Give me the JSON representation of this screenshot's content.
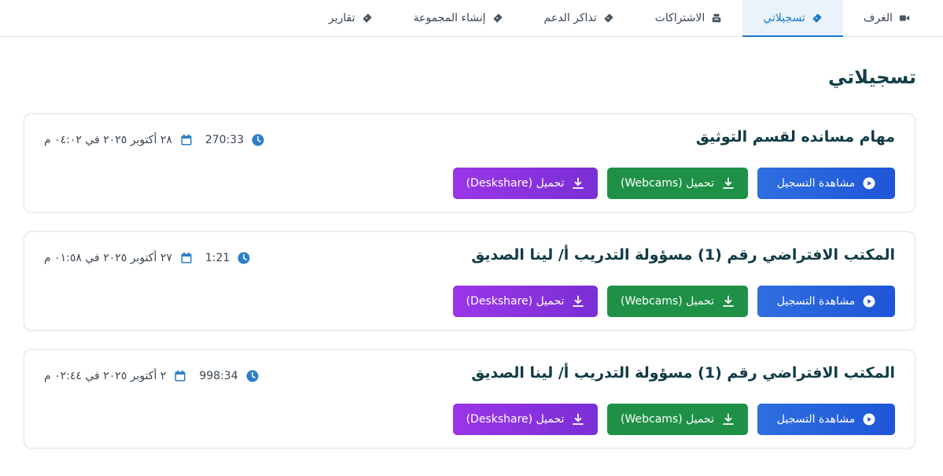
{
  "tabs": [
    {
      "label": "الغرف",
      "icon": "video-camera-icon",
      "active": false
    },
    {
      "label": "تسجيلاتي",
      "icon": "ticket-icon",
      "active": true
    },
    {
      "label": "الاشتراكات",
      "icon": "cash-register-icon",
      "active": false
    },
    {
      "label": "تذاكر الدعم",
      "icon": "ticket-icon",
      "active": false
    },
    {
      "label": "إنشاء المجموعة",
      "icon": "ticket-icon",
      "active": false
    },
    {
      "label": "تقارير",
      "icon": "ticket-icon",
      "active": false
    }
  ],
  "page_title": "تسجيلاتي",
  "buttons": {
    "view": "مشاهدة التسجيل",
    "webcams": "تحميل (Webcams)",
    "deskshare": "تحميل (Deskshare)"
  },
  "colors": {
    "accent": "#1a77c9",
    "view": "#1e56d8",
    "webcams": "#1e9146",
    "deskshare": "#8a33e0"
  },
  "recordings": [
    {
      "title": "مهام مسانده لقسم التوثيق",
      "duration": "270:33",
      "date": "٢٨ أكتوبر ٢٠٢٥ في ٠٤:٠٢ م"
    },
    {
      "title": "المكتب الافتراضي رقم (1) مسؤولة التدريب أ/ لينا الصديق",
      "duration": "1:21",
      "date": "٢٧ أكتوبر ٢٠٢٥ في ٠١:٥٨ م"
    },
    {
      "title": "المكتب الافتراضي رقم (1) مسؤولة التدريب أ/ لينا الصديق",
      "duration": "998:34",
      "date": "٢ أكتوبر ٢٠٢٥ في ٠٢:٤٤ م"
    }
  ]
}
